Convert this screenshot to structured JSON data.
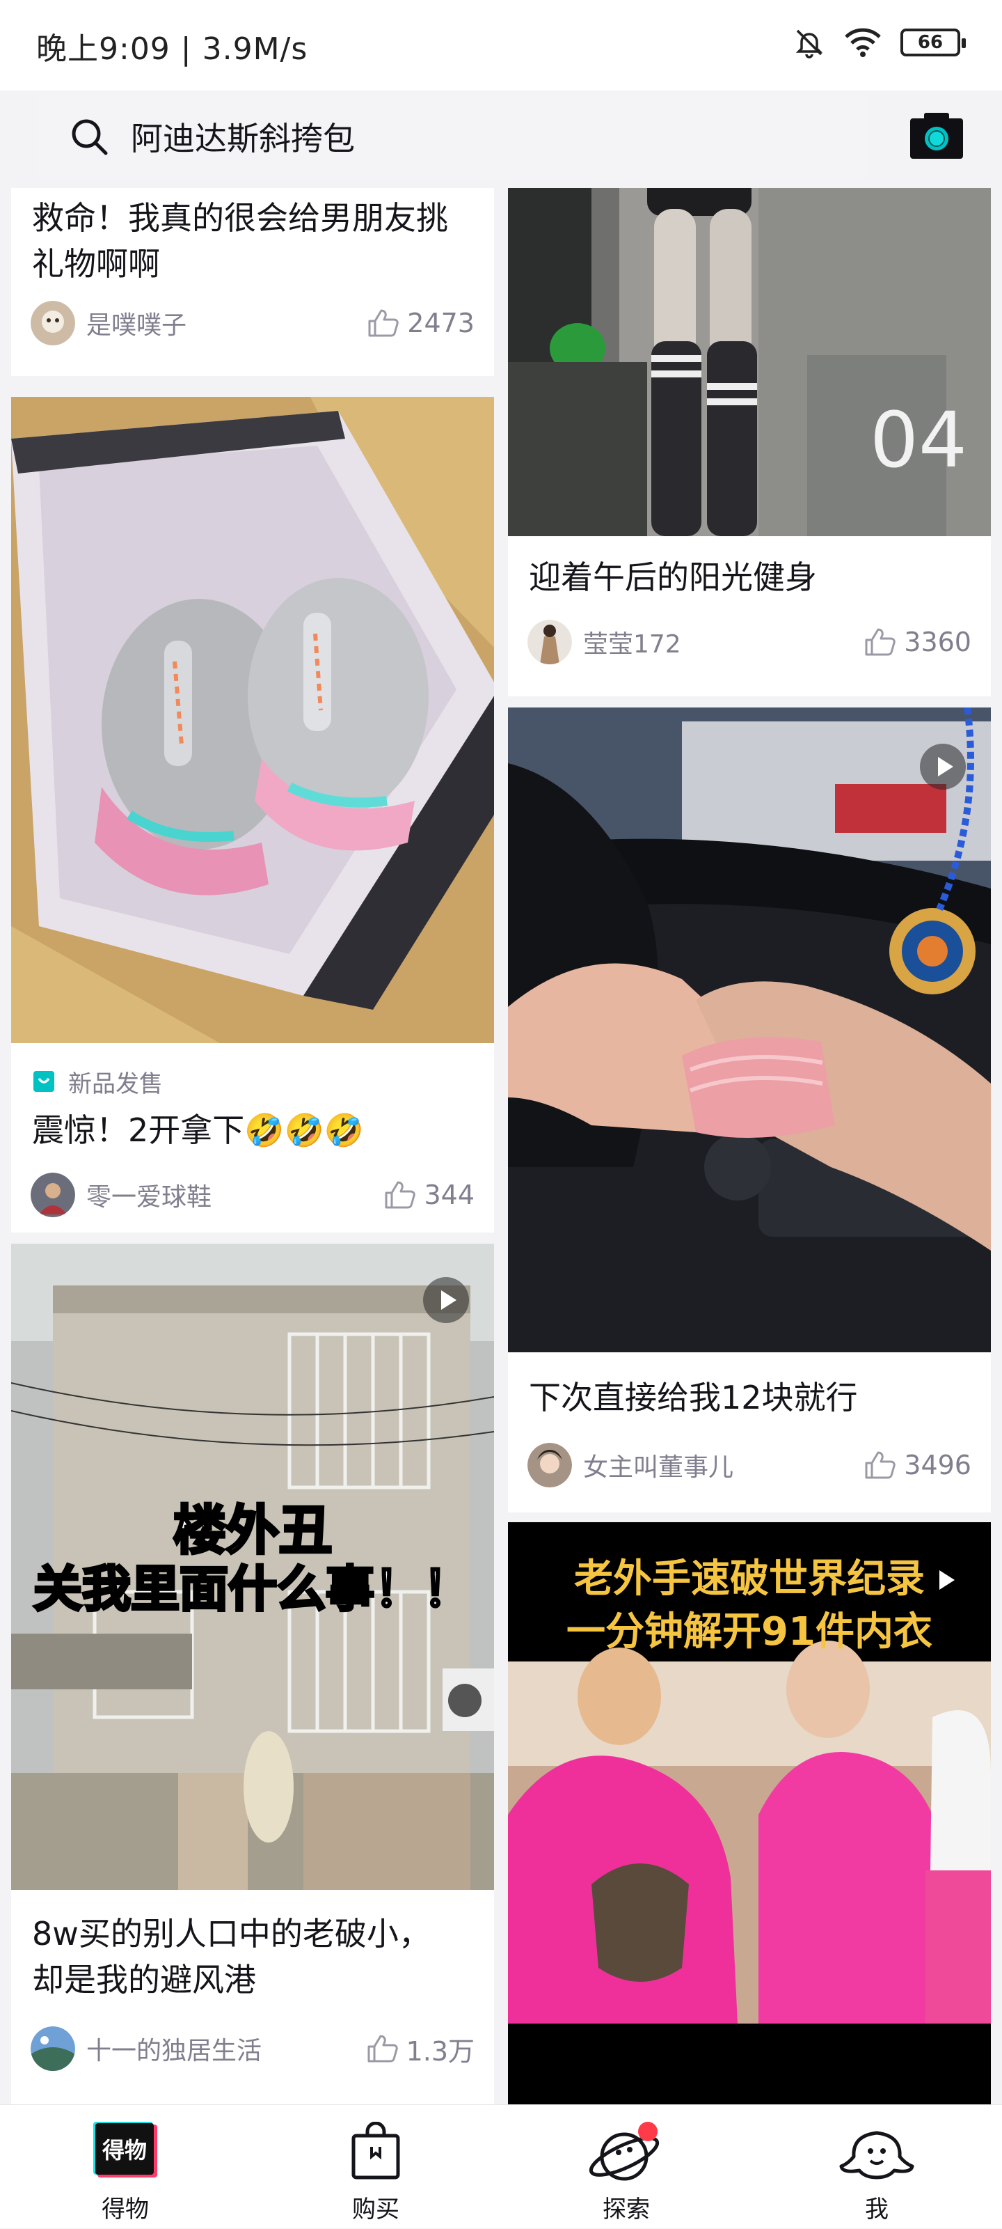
{
  "status": {
    "text": "晚上9:09 | 3.9M/s",
    "battery": "66"
  },
  "search": {
    "query": "阿迪达斯斜挎包"
  },
  "feed": {
    "card1": {
      "title": "救命！我真的很会给男朋友挑礼物啊啊",
      "author": "是噗噗子",
      "likes": "2473"
    },
    "card2": {
      "tag": "新品发售",
      "title": "震惊！2开拿下🤣🤣🤣",
      "author": "零一爱球鞋",
      "likes": "344"
    },
    "card3": {
      "overlay_line1": "楼外丑",
      "overlay_line2": "关我里面什么事！！",
      "title_line1": "8w买的别人口中的老破小，",
      "title_line2": "却是我的避风港",
      "author": "十一的独居生活",
      "likes": "1.3万"
    },
    "card4": {
      "photo_text": "04",
      "title": "迎着午后的阳光健身",
      "author": "莹莹172",
      "likes": "3360"
    },
    "card5": {
      "title": "下次直接给我12块就行",
      "author": "女主叫董事儿",
      "likes": "3496"
    },
    "card6": {
      "caption_line1": "老外手速破世界纪录",
      "caption_line2": "一分钟解开91件内衣"
    }
  },
  "tabs": [
    {
      "label": "得物"
    },
    {
      "label": "购买"
    },
    {
      "label": "探索"
    },
    {
      "label": "我"
    }
  ],
  "logo_text": "得物",
  "colors": {
    "accent": "#01c2c3",
    "badge": "#ff3b4a",
    "text": "#14151a",
    "muted": "#7f7f8e"
  }
}
